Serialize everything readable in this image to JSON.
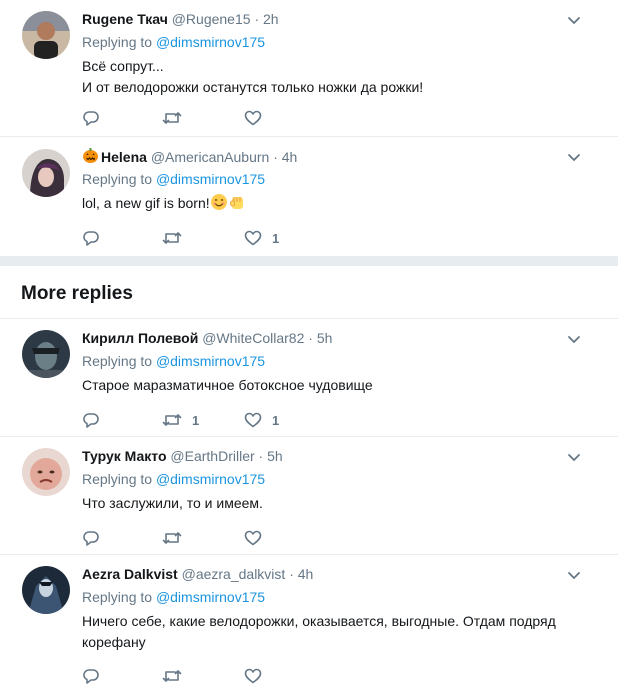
{
  "tweets_top": [
    {
      "name": "Rugene Ткач",
      "handle": "@Rugene15",
      "separator": "·",
      "time": "2h",
      "reply_prefix": "Replying to",
      "reply_to": "@dimsmirnov175",
      "body_lines": [
        "Всё сопрут...",
        "И от велодорожки останутся только ножки да рожки!"
      ],
      "retweets": "",
      "likes": ""
    },
    {
      "name": "Helena",
      "name_prefix_icon": "jack-o-lantern-icon",
      "handle": "@AmericanAuburn",
      "separator": "·",
      "time": "4h",
      "reply_prefix": "Replying to",
      "reply_to": "@dimsmirnov175",
      "body_lines": [
        "lol, a new gif is born!"
      ],
      "body_emojis": [
        "smiling-face-icon",
        "raised-fist-icon"
      ],
      "retweets": "",
      "likes": "1"
    }
  ],
  "more_replies": {
    "title": "More replies"
  },
  "tweets_more": [
    {
      "name": "Кирилл Полевой",
      "handle": "@WhiteCollar82",
      "separator": "·",
      "time": "5h",
      "reply_prefix": "Replying to",
      "reply_to": "@dimsmirnov175",
      "body_lines": [
        "Старое маразматичное ботоксное чудовище"
      ],
      "retweets": "1",
      "likes": "1"
    },
    {
      "name": "Турук Макто",
      "handle": "@EarthDriller",
      "separator": "·",
      "time": "5h",
      "reply_prefix": "Replying to",
      "reply_to": "@dimsmirnov175",
      "body_lines": [
        "Что заслужили, то и имеем."
      ],
      "retweets": "",
      "likes": ""
    },
    {
      "name": "Aezra Dalkvist",
      "handle": "@aezra_dalkvist",
      "separator": "·",
      "time": "4h",
      "reply_prefix": "Replying to",
      "reply_to": "@dimsmirnov175",
      "body_lines": [
        "Ничего себе, какие велодорожки, оказывается, выгодные. Отдам подряд",
        "корефану"
      ],
      "retweets": "",
      "likes": ""
    }
  ],
  "colors": {
    "link": "#1b95e0",
    "muted": "#657786",
    "divider": "#e6ecf0"
  }
}
